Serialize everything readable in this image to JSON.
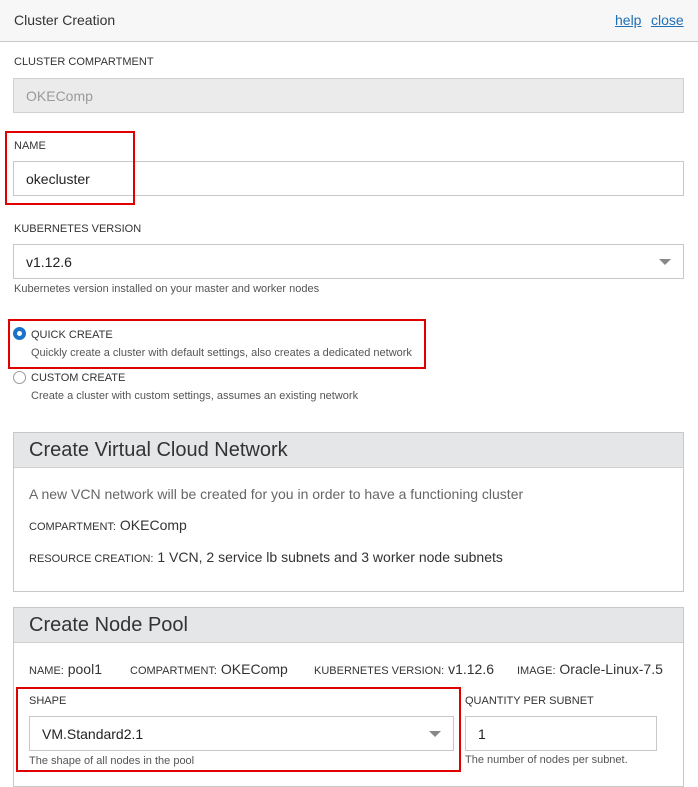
{
  "header": {
    "title": "Cluster Creation",
    "help": "help",
    "close": "close"
  },
  "compartment": {
    "label": "CLUSTER COMPARTMENT",
    "value": "OKEComp"
  },
  "name": {
    "label": "NAME",
    "value": "okecluster"
  },
  "k8s": {
    "label": "KUBERNETES VERSION",
    "value": "v1.12.6",
    "hint": "Kubernetes version installed on your master and worker nodes"
  },
  "quick_create": {
    "label": "QUICK CREATE",
    "desc": "Quickly create a cluster with default settings, also creates a dedicated network",
    "selected": true
  },
  "custom_create": {
    "label": "CUSTOM CREATE",
    "desc": "Create a cluster with custom settings, assumes an existing network",
    "selected": false
  },
  "vcn": {
    "title": "Create Virtual Cloud Network",
    "intro": "A new VCN network will be created for you in order to have a functioning cluster",
    "compartment_key": "COMPARTMENT:",
    "compartment_val": "OKEComp",
    "resource_key": "RESOURCE CREATION:",
    "resource_val": "1 VCN, 2 service lb subnets and 3 worker node subnets"
  },
  "pool": {
    "title": "Create Node Pool",
    "name_key": "NAME:",
    "name_val": "pool1",
    "compartment_key": "COMPARTMENT:",
    "compartment_val": "OKEComp",
    "k8s_key": "KUBERNETES VERSION:",
    "k8s_val": "v1.12.6",
    "image_key": "IMAGE:",
    "image_val": "Oracle-Linux-7.5",
    "shape_label": "SHAPE",
    "shape_value": "VM.Standard2.1",
    "shape_hint": "The shape of all nodes in the pool",
    "qty_label": "QUANTITY PER SUBNET",
    "qty_value": "1",
    "qty_hint": "The number of nodes per subnet."
  },
  "colors": {
    "link": "#1f6fb5",
    "highlight": "#e00000",
    "radio_selected": "#1a73c9"
  }
}
